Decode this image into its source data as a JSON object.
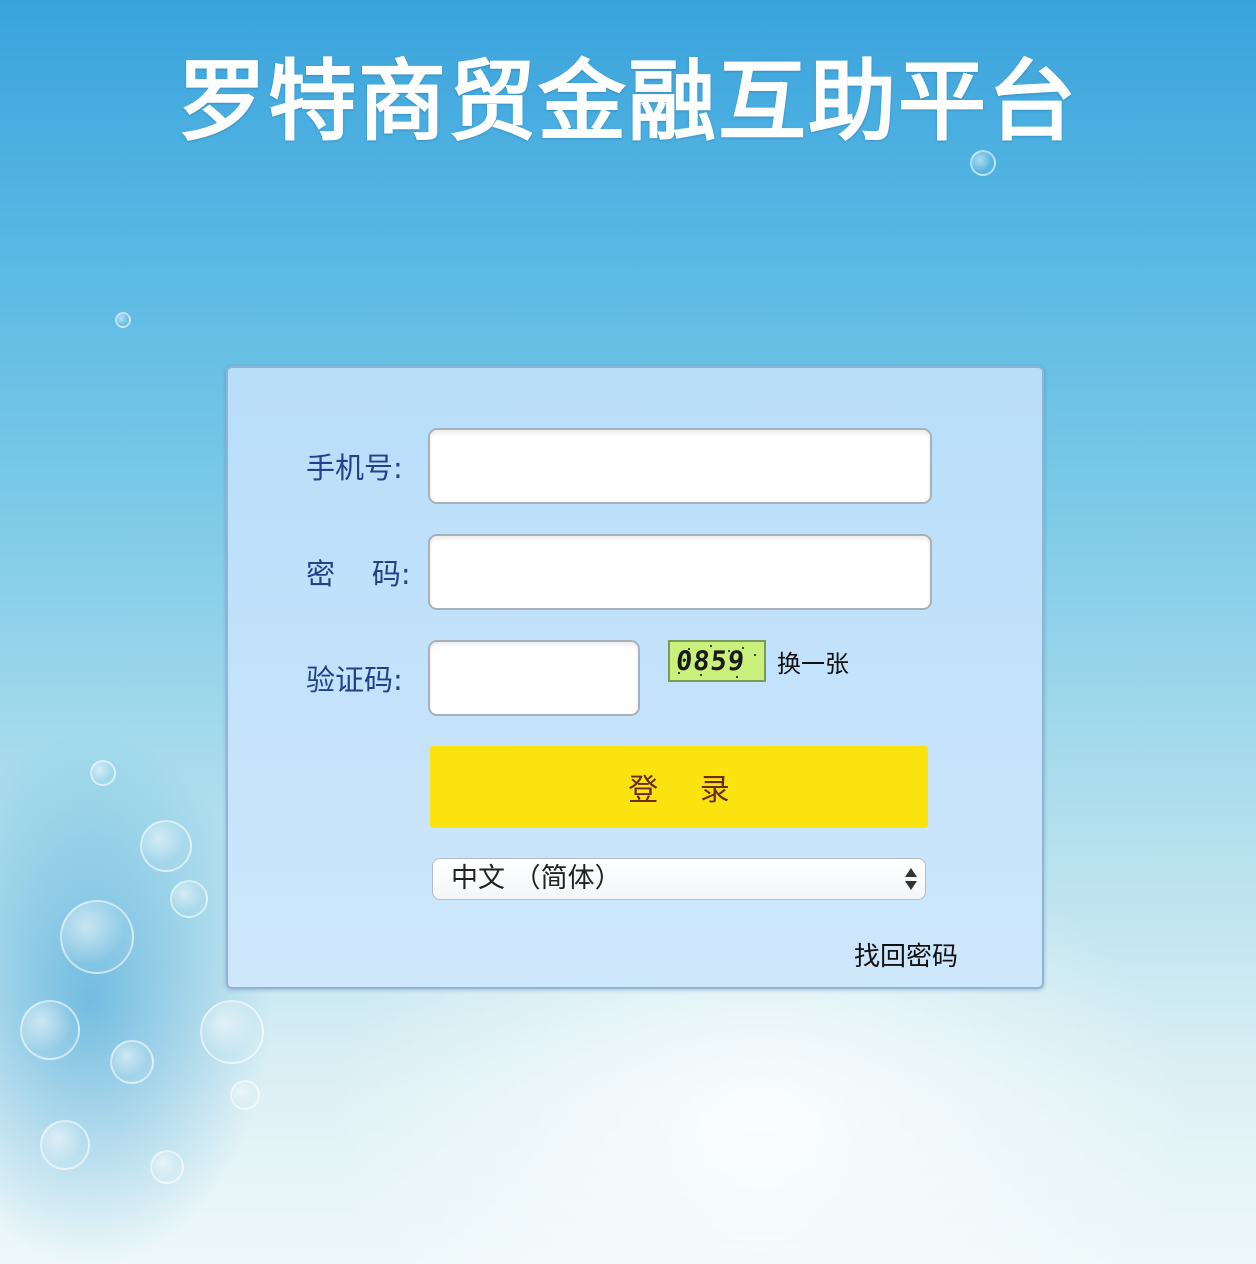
{
  "header": {
    "title": "罗特商贸金融互助平台"
  },
  "login_form": {
    "phone_label": "手机号:",
    "phone_value": "",
    "password_label": "密    码:",
    "password_value": "",
    "captcha_label": "验证码:",
    "captcha_value": "",
    "captcha_image_text": "0859",
    "refresh_captcha_label": "换一张",
    "login_button_label": "登 录",
    "language_selected": "中文 （简体）",
    "forgot_password_label": "找回密码"
  },
  "colors": {
    "login_button": "#fbe30f",
    "label_text": "#23418a",
    "panel_background": "#c3e2fb"
  }
}
